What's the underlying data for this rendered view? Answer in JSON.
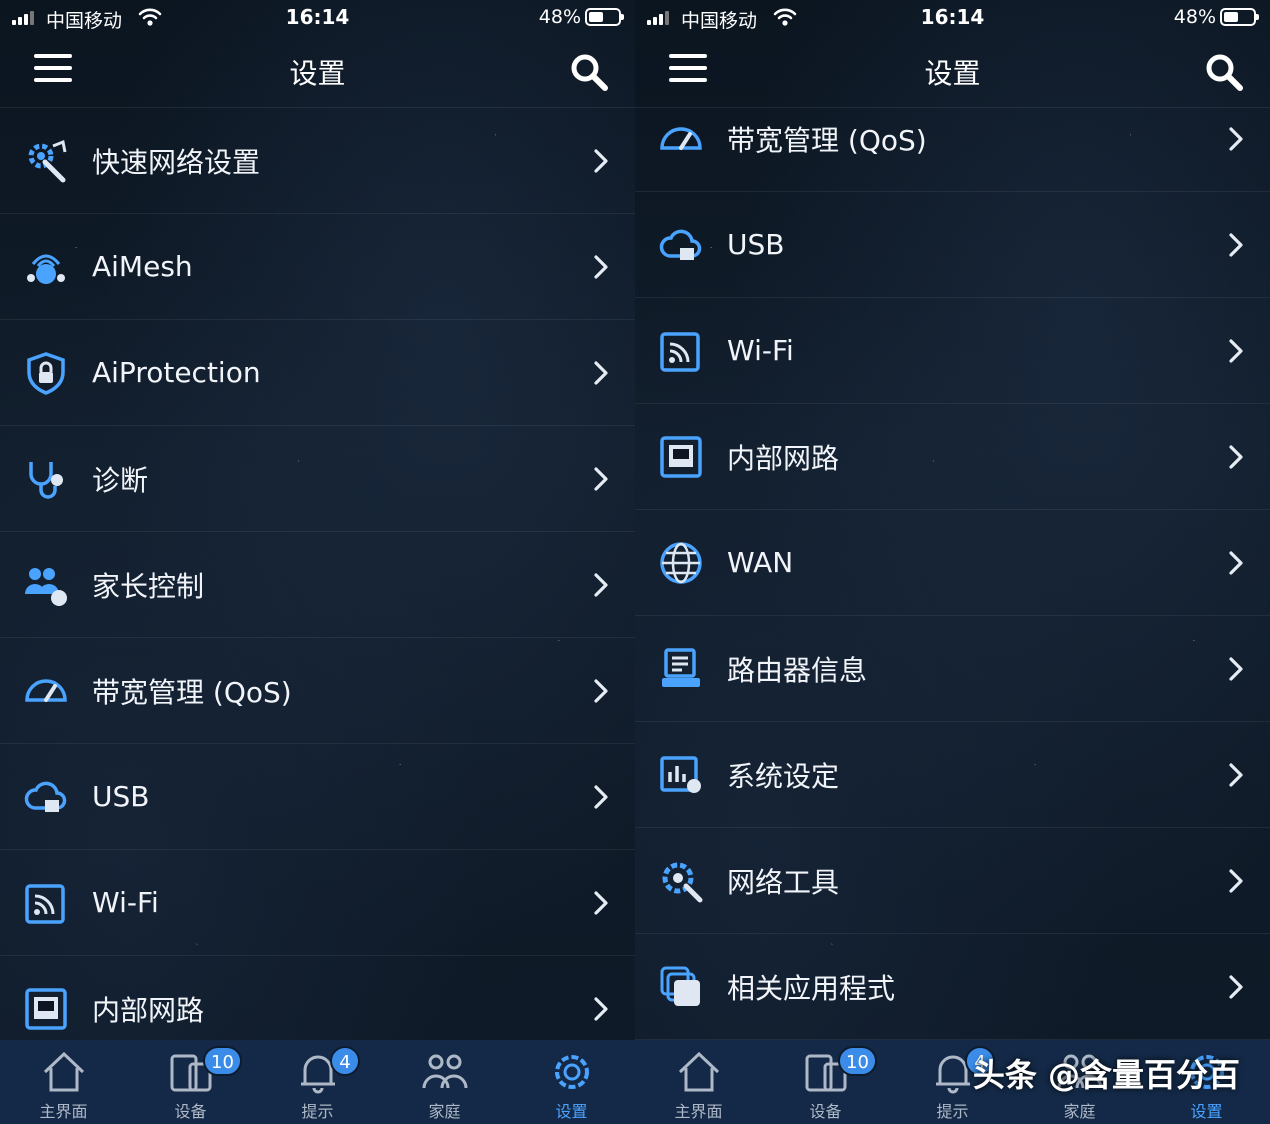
{
  "colors": {
    "accent": "#3b8ce8",
    "icon_blue": "#4aa3ff",
    "tab_bar": "#132947",
    "background": "#0c1521"
  },
  "status_bar": {
    "carrier": "中国移动",
    "time": "16:14",
    "battery": "48%",
    "battery_level": 0.48
  },
  "header": {
    "title": "设置",
    "menu_icon": "menu-icon",
    "search_icon": "search-icon"
  },
  "left_screen": {
    "items": [
      {
        "label": "快速网络设置",
        "icon": "quick-setup-icon"
      },
      {
        "label": "AiMesh",
        "icon": "aimesh-icon"
      },
      {
        "label": "AiProtection",
        "icon": "shield-lock-icon"
      },
      {
        "label": "诊断",
        "icon": "stethoscope-icon"
      },
      {
        "label": "家长控制",
        "icon": "parental-control-icon"
      },
      {
        "label": "带宽管理 (QoS)",
        "icon": "speedometer-icon"
      },
      {
        "label": "USB",
        "icon": "usb-cloud-icon"
      },
      {
        "label": "Wi-Fi",
        "icon": "wifi-signal-icon"
      },
      {
        "label": "内部网路",
        "icon": "lan-port-icon"
      }
    ]
  },
  "right_screen": {
    "items": [
      {
        "label": "带宽管理 (QoS)",
        "icon": "speedometer-icon"
      },
      {
        "label": "USB",
        "icon": "usb-cloud-icon"
      },
      {
        "label": "Wi-Fi",
        "icon": "wifi-signal-icon"
      },
      {
        "label": "内部网路",
        "icon": "lan-port-icon"
      },
      {
        "label": "WAN",
        "icon": "globe-icon"
      },
      {
        "label": "路由器信息",
        "icon": "router-info-icon"
      },
      {
        "label": "系统设定",
        "icon": "system-settings-icon"
      },
      {
        "label": "网络工具",
        "icon": "network-tools-icon"
      },
      {
        "label": "相关应用程式",
        "icon": "related-apps-icon"
      }
    ]
  },
  "tabs": [
    {
      "label": "主界面",
      "icon": "home-icon",
      "badge": ""
    },
    {
      "label": "设备",
      "icon": "devices-icon",
      "badge": "10"
    },
    {
      "label": "提示",
      "icon": "bell-icon",
      "badge": "4"
    },
    {
      "label": "家庭",
      "icon": "family-icon",
      "badge": ""
    },
    {
      "label": "设置",
      "icon": "gear-icon",
      "badge": ""
    }
  ],
  "watermark": "头条 @含量百分百"
}
